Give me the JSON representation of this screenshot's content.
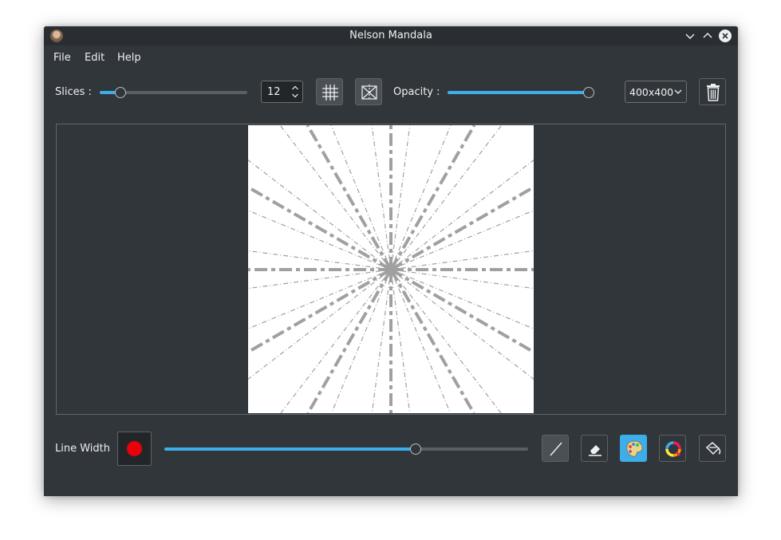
{
  "window": {
    "title": "Nelson Mandala"
  },
  "menu": {
    "file": "File",
    "edit": "Edit",
    "help": "Help"
  },
  "toolbar": {
    "slices_label": "Slices :",
    "slices_value": "12",
    "slices_slider_fraction": 0.14,
    "opacity_label": "Opacity :",
    "opacity_slider_fraction": 1.0,
    "canvas_size": "400x400",
    "icons": {
      "grid": "grid-icon",
      "mirror": "mirror-icon",
      "size_dropdown": "chevron-down-icon",
      "trash": "trash-icon"
    }
  },
  "bottom": {
    "line_width_label": "Line Width",
    "line_width_fraction": 0.69,
    "current_color": "#e8000b",
    "tools": [
      {
        "name": "line-tool",
        "icon": "line-icon"
      },
      {
        "name": "eraser-tool",
        "icon": "eraser-icon"
      },
      {
        "name": "palette-tool",
        "icon": "palette-icon",
        "active": true
      },
      {
        "name": "color-wheel-tool",
        "icon": "color-wheel-icon"
      },
      {
        "name": "fill-tool",
        "icon": "paint-bucket-icon"
      }
    ]
  },
  "colors": {
    "window_bg": "#31363b",
    "accent": "#3daee9",
    "canvas_bg": "#ffffff",
    "stroke": "#a0a0a0"
  }
}
